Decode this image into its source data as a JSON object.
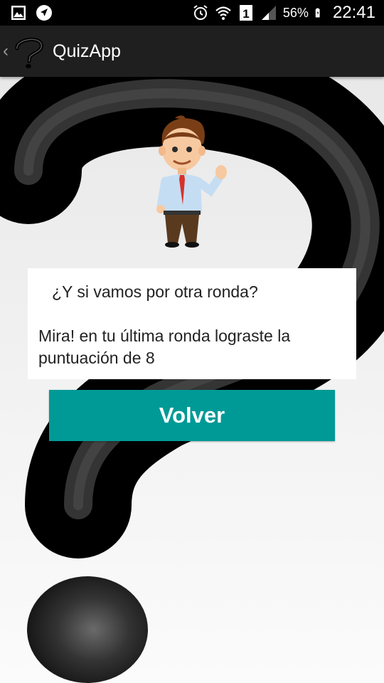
{
  "status_bar": {
    "icons_left": [
      "gallery-icon",
      "navigation-icon"
    ],
    "icons_right": [
      "alarm-icon",
      "wifi-icon",
      "sim-1-icon",
      "signal-icon",
      "battery-icon"
    ],
    "battery": "56%",
    "time": "22:41"
  },
  "action_bar": {
    "title": "QuizApp",
    "logo_icon": "question-mark-icon",
    "back_icon": "chevron-left-icon"
  },
  "card": {
    "question": "¿Y si vamos por otra ronda?",
    "message": "Mira! en tu última ronda lograste la puntuación de 8"
  },
  "button": {
    "label": "Volver",
    "color": "#009a96"
  },
  "colors": {
    "action_bar": "#1f1f1f",
    "status_bar": "#000000",
    "background": "#f2f2f2"
  }
}
